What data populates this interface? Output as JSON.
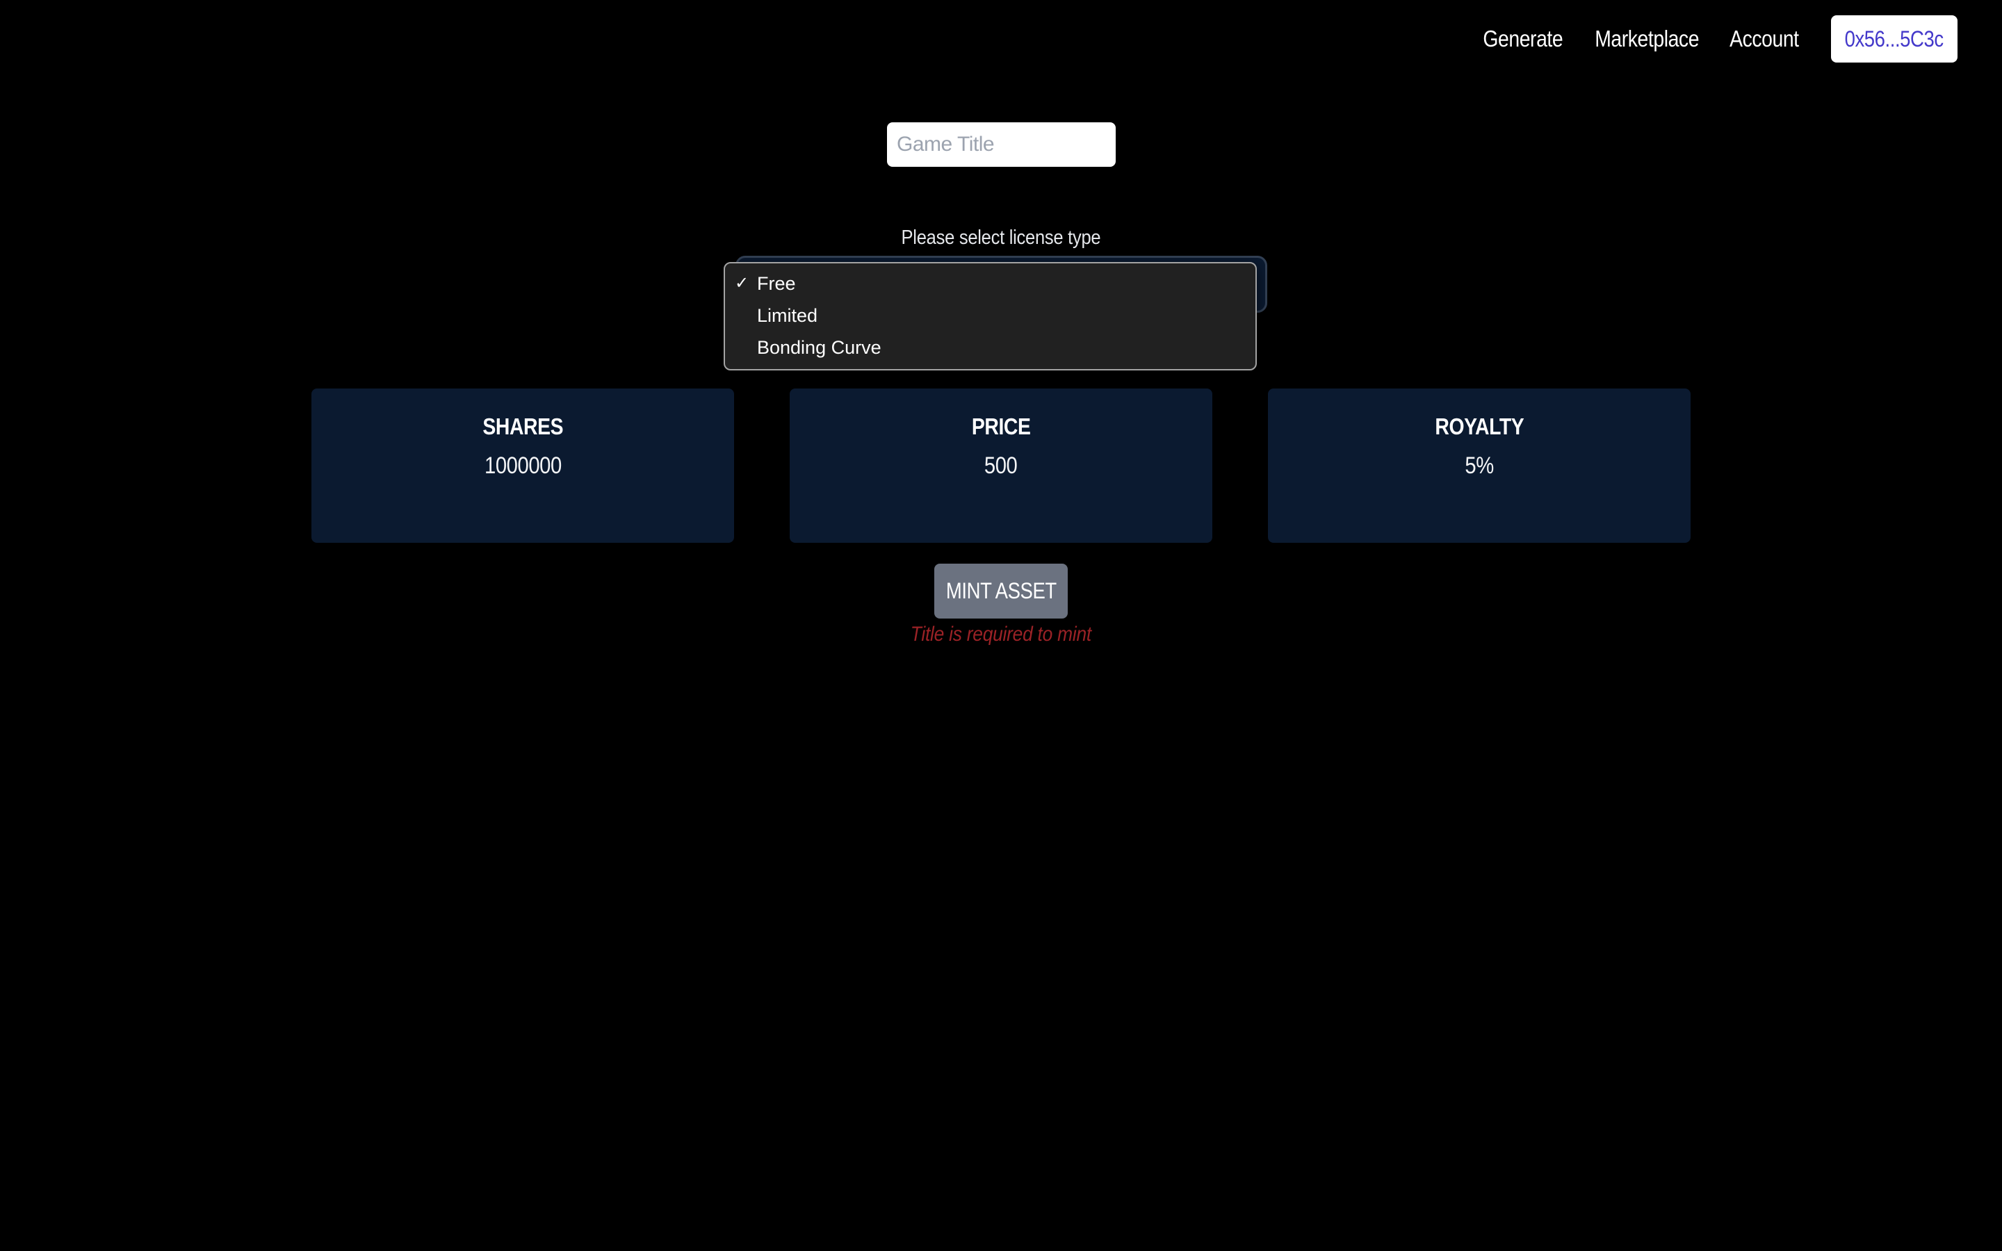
{
  "nav": {
    "links": [
      {
        "label": "Generate"
      },
      {
        "label": "Marketplace"
      },
      {
        "label": "Account"
      }
    ],
    "wallet_address": "0x56...5C3c"
  },
  "form": {
    "title_input": {
      "value": "",
      "placeholder": "Game Title"
    },
    "license": {
      "label": "Please select license type",
      "selected": "Free",
      "options": [
        {
          "label": "Free",
          "checked": true
        },
        {
          "label": "Limited",
          "checked": false
        },
        {
          "label": "Bonding Curve",
          "checked": false
        }
      ],
      "check_icon": "✓",
      "chevron_icon": "⌄"
    }
  },
  "stats": [
    {
      "label": "SHARES",
      "value": "1000000"
    },
    {
      "label": "PRICE",
      "value": "500"
    },
    {
      "label": "ROYALTY",
      "value": "5%"
    }
  ],
  "mint": {
    "button_label": "MINT ASSET",
    "error": "Title is required to mint"
  },
  "colors": {
    "background": "#000000",
    "card": "#0b1a30",
    "wallet_text": "#4338ca",
    "mint_button": "#6b7280",
    "error": "#9b2226",
    "dropdown_bg": "#212121"
  }
}
